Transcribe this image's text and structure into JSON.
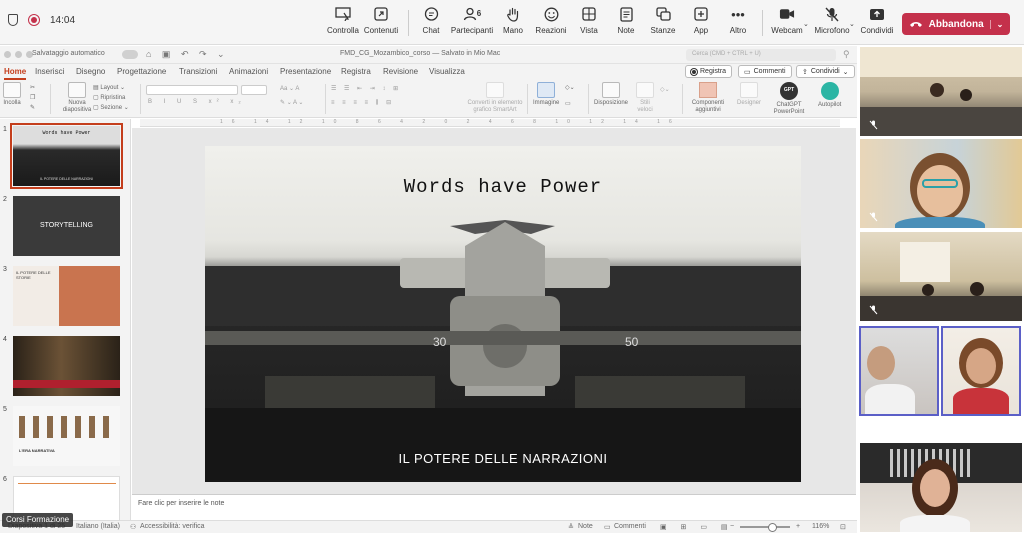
{
  "teams": {
    "timer": "14:04",
    "participants_count": "6",
    "buttons": [
      {
        "id": "controlla",
        "label": "Controlla",
        "icon": "screen-control-icon"
      },
      {
        "id": "contenuti",
        "label": "Contenuti",
        "icon": "share-content-icon"
      },
      {
        "id": "chat",
        "label": "Chat",
        "icon": "chat-icon"
      },
      {
        "id": "partecipanti",
        "label": "Partecipanti",
        "icon": "people-icon"
      },
      {
        "id": "mano",
        "label": "Mano",
        "icon": "raise-hand-icon"
      },
      {
        "id": "reazioni",
        "label": "Reazioni",
        "icon": "emoji-icon"
      },
      {
        "id": "vista",
        "label": "Vista",
        "icon": "grid-view-icon"
      },
      {
        "id": "note",
        "label": "Note",
        "icon": "notes-icon"
      },
      {
        "id": "stanze",
        "label": "Stanze",
        "icon": "breakout-rooms-icon"
      },
      {
        "id": "app",
        "label": "App",
        "icon": "add-app-icon"
      },
      {
        "id": "altro",
        "label": "Altro",
        "icon": "more-icon"
      },
      {
        "id": "webcam",
        "label": "Webcam",
        "icon": "camera-icon"
      },
      {
        "id": "microfono",
        "label": "Microfono",
        "icon": "mic-muted-icon"
      },
      {
        "id": "condividi",
        "label": "Condividi",
        "icon": "share-screen-icon"
      }
    ],
    "leave_label": "Abbandona",
    "accent": "#c4314b"
  },
  "ppt": {
    "autosave_label": "Salvataggio automatico",
    "doc_title": "FMD_CG_Mozambico_corso — Salvato in Mio Mac",
    "search_placeholder": "Cerca (CMD + CTRL + U)",
    "tabs": [
      "Home",
      "Inserisci",
      "Disegno",
      "Progettazione",
      "Transizioni",
      "Animazioni",
      "Presentazione",
      "Revisione",
      "Visualizza"
    ],
    "active_tab": "Home",
    "registra_tab": "Registra",
    "record_label": "Registra",
    "comments_label": "Commenti",
    "share_label": "Condividi",
    "ribbon": {
      "paste": "Incolla",
      "new_slide": "Nuova diapositiva",
      "layout": "Layout",
      "reset": "Ripristina",
      "section": "Sezione",
      "smartart": "Converti in elemento grafico SmartArt",
      "image": "Immagine",
      "arrange": "Disposizione",
      "quick_styles": "Stili veloci",
      "addins": "Componenti aggiuntivi",
      "designer": "Designer",
      "chatgpt": "ChatGPT PowerPoint",
      "chatgpt_badge": "GPT",
      "autopilot": "Autopilot"
    },
    "thumbnails": [
      {
        "num": "1",
        "title": "Words have Power",
        "subtitle": "IL POTERE DELLE NARRAZIONI",
        "bg": "#2a2a2a",
        "selected": true
      },
      {
        "num": "2",
        "title": "STORYTELLING",
        "bg": "#3a3a3a",
        "selected": false
      },
      {
        "num": "3",
        "title": "IL POTERE DELLE STORIE",
        "bg": "#c9744f",
        "selected": false
      },
      {
        "num": "4",
        "title": "",
        "bg": "#4a3a2a",
        "selected": false
      },
      {
        "num": "5",
        "title": "L'ERA NARRATIVA",
        "bg": "#f5f5f5",
        "selected": false
      },
      {
        "num": "6",
        "title": "",
        "bg": "#ffffff",
        "selected": false
      }
    ],
    "slide": {
      "title": "Words have Power",
      "subtitle": "IL POTERE DELLE NARRAZIONI"
    },
    "notes_placeholder": "Fare clic per inserire le note",
    "status": {
      "slide_counter": "Diapositiva 1 di 25",
      "language": "Italiano (Italia)",
      "accessibility": "Accessibilità: verifica",
      "notes_btn": "Note",
      "comments_btn": "Commenti",
      "zoom": "116%"
    },
    "accent": "#c43e1c"
  },
  "overlay_label": "Corsi Formazione"
}
